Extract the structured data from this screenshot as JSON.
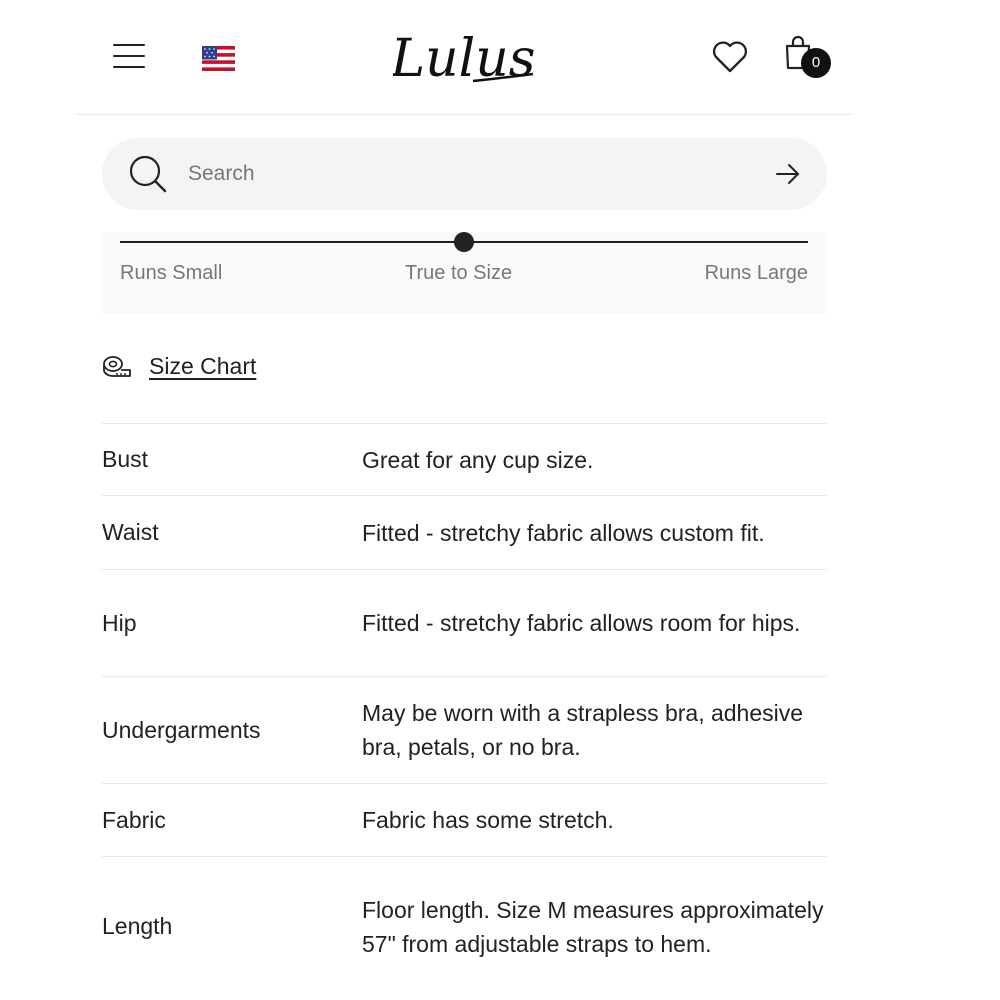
{
  "header": {
    "logo_text": "Lulus",
    "cart_count": "0"
  },
  "search": {
    "placeholder": "Search"
  },
  "fit_scale": {
    "labels": [
      "Runs Small",
      "True to Size",
      "Runs Large"
    ],
    "position": 0.5
  },
  "size_chart": {
    "label": "Size Chart"
  },
  "fit_details": [
    {
      "attribute": "Bust",
      "description": "Great for any cup size."
    },
    {
      "attribute": "Waist",
      "description": "Fitted - stretchy fabric allows custom fit."
    },
    {
      "attribute": "Hip",
      "description": "Fitted - stretchy fabric allows room for hips."
    },
    {
      "attribute": "Undergarments",
      "description": "May be worn with a strapless bra, adhesive bra, petals, or no bra."
    },
    {
      "attribute": "Fabric",
      "description": "Fabric has some stretch."
    },
    {
      "attribute": "Length",
      "description": "Floor length. Size M measures approximately 57\" from adjustable straps to hem."
    }
  ],
  "colors": {
    "text": "#222222",
    "muted": "#777777",
    "search_bg": "#f4f4f4",
    "badge": "#111111"
  }
}
